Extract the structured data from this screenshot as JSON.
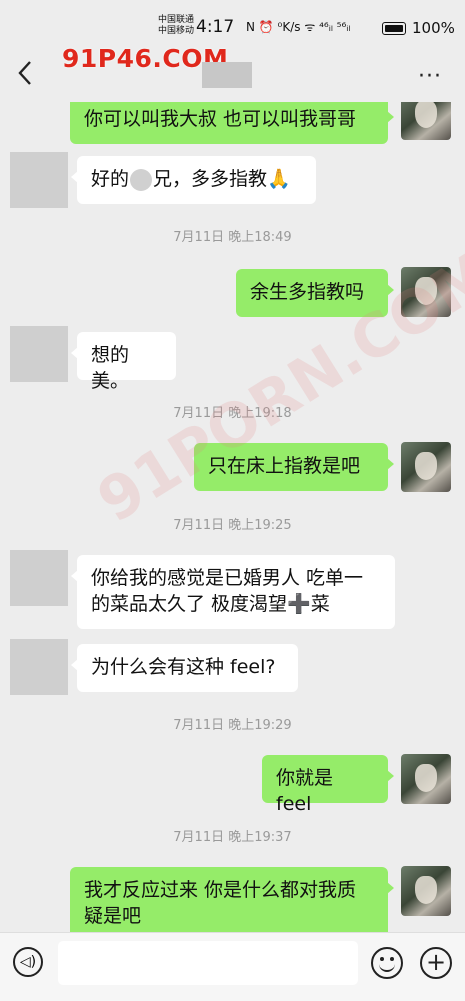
{
  "status_bar": {
    "carrier_1": "中国联通",
    "carrier_2": "中国移动",
    "time": "4:17",
    "icons_text": "N ⏰ ⁰K/s ᯤ ⁴⁶ᵢₗ ⁵⁶ᵢₗ",
    "battery_percent": "100%"
  },
  "header": {
    "watermark": "91P46.COM",
    "back_icon": "chevron-left-icon",
    "more_label": "···"
  },
  "background_watermark": "91PORN.COM",
  "messages": [
    {
      "side": "out",
      "text": "你可以叫我大叔 也可以叫我哥哥"
    },
    {
      "side": "in",
      "text_before": "好的",
      "text_after": "兄，多多指教🙏"
    },
    {
      "type": "time",
      "text": "7月11日 晚上18:49"
    },
    {
      "side": "out",
      "text": "余生多指教吗"
    },
    {
      "side": "in",
      "text": "想的美。"
    },
    {
      "type": "time",
      "text": "7月11日 晚上19:18"
    },
    {
      "side": "out",
      "text": "只在床上指教是吧"
    },
    {
      "type": "time",
      "text": "7月11日 晚上19:25"
    },
    {
      "side": "in",
      "line1": "你给我的感觉是已婚男人 吃单一",
      "line2": "的菜品太久了 极度渴望➕菜"
    },
    {
      "side": "in",
      "text": "为什么会有这种 feel?"
    },
    {
      "type": "time",
      "text": "7月11日 晚上19:29"
    },
    {
      "side": "out",
      "text": "你就是 feel"
    },
    {
      "type": "time",
      "text": "7月11日 晚上19:37"
    },
    {
      "side": "out",
      "line1": "我才反应过来 你是什么都对我质",
      "line2": "疑是吧"
    }
  ],
  "input_bar": {
    "voice_icon": "voice-icon",
    "emoji_icon": "emoji-icon",
    "plus_label": "+"
  }
}
